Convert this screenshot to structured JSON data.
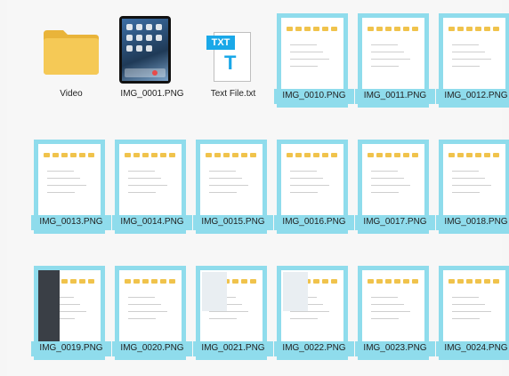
{
  "files": [
    {
      "name": "Video",
      "icon": "folder-icon"
    },
    {
      "name": "IMG_0001.PNG",
      "icon": "ios-home-screen-thumbnail"
    },
    {
      "name": "Text File.txt",
      "icon": "text-file-icon",
      "badge": "TXT",
      "glyph": "T"
    },
    {
      "name": "IMG_0010.PNG",
      "selected": true
    },
    {
      "name": "IMG_0011.PNG",
      "selected": true
    },
    {
      "name": "IMG_0012.PNG",
      "selected": true
    },
    {
      "name": "IMG_0013.PNG",
      "selected": true
    },
    {
      "name": "IMG_0014.PNG",
      "selected": true
    },
    {
      "name": "IMG_0015.PNG",
      "selected": true
    },
    {
      "name": "IMG_0016.PNG",
      "selected": true
    },
    {
      "name": "IMG_0017.PNG",
      "selected": true
    },
    {
      "name": "IMG_0018.PNG",
      "selected": true
    },
    {
      "name": "IMG_0019.PNG",
      "selected": true
    },
    {
      "name": "IMG_0020.PNG",
      "selected": true
    },
    {
      "name": "IMG_0021.PNG",
      "selected": true
    },
    {
      "name": "IMG_0022.PNG",
      "selected": true
    },
    {
      "name": "IMG_0023.PNG",
      "selected": true
    },
    {
      "name": "IMG_0024.PNG",
      "selected": true
    }
  ],
  "colors": {
    "selection": "#8fdcec",
    "folder": "#f0c34c",
    "text_file_accent": "#1aa8e8"
  }
}
